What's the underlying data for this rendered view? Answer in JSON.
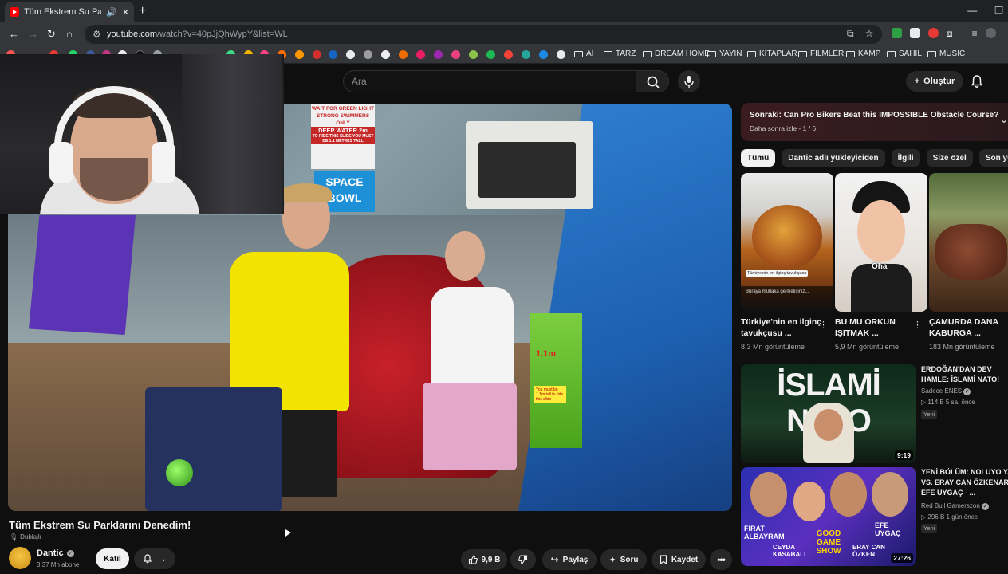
{
  "browser": {
    "tab_title": "Tüm Ekstrem Su Parklarını D",
    "new_tab": "+",
    "window_buttons": [
      "—",
      "❐"
    ],
    "url_host": "youtube.com",
    "url_path": "/watch?v=40pJjQhWypY&list=WL",
    "bookmarks": [
      {
        "label": "AI"
      },
      {
        "label": "TARZ"
      },
      {
        "label": "DREAM HOME"
      },
      {
        "label": "YAYIN"
      },
      {
        "label": "KİTAPLAR"
      },
      {
        "label": "FİLMLER"
      },
      {
        "label": "KAMP"
      },
      {
        "label": "SAHİL"
      },
      {
        "label": "MUSIC"
      }
    ]
  },
  "header": {
    "search_placeholder": "Ara",
    "create_label": "Oluştur"
  },
  "video": {
    "title": "Tüm Ekstrem Su Parklarını Denedim!",
    "dubbed_label": "Dublajlı",
    "channel": "Dantic",
    "subscribers": "3,37 Mn abone",
    "join_label": "Katıl",
    "likes": "9,9 B",
    "share_label": "Paylaş",
    "ask_label": "Soru",
    "save_label": "Kaydet",
    "scene_signs": {
      "sign1": "WAIT FOR GREEN LIGHT",
      "sign2": "STRONG SWIMMERS ONLY",
      "sign3": "DEEP WATER 2m",
      "sign4": "TO RIDE THIS SLIDE YOU MUST BE 1.1 METRES TALL",
      "bowl": "SPACE BOWL",
      "height": "1.1m",
      "height_note": "You must be 1.1m tall to ride this slide"
    }
  },
  "sidebar": {
    "next_prefix": "Sonraki:",
    "next_title": "Can Pro Bikers Beat this IMPOSSIBLE Obstacle Course?",
    "playlist_meta": "Daha sonra izle - 1 / 6",
    "chips": [
      "Tümü",
      "Dantic adlı yükleyiciden",
      "İlgili",
      "Size özel",
      "Son yükl"
    ],
    "shorts": [
      {
        "title": "Türkiye'nin en ilginç tavukçusu ...",
        "views": "8,3 Mn görüntüleme",
        "caption1": "Türkiye'nin en ilginç tavukçusu",
        "caption2": "Buraya mutlaka gelmelisiniz..."
      },
      {
        "title": "BU MU ORKUN IŞITMAK ...",
        "views": "5,9 Mn görüntüleme",
        "caption1": "Oha"
      },
      {
        "title": "ÇAMURDA DANA KABURGA ...",
        "views": "183 Mn görüntüleme"
      }
    ],
    "videos": [
      {
        "title": "ERDOĞAN'DAN DEV HAMLE: İSLAMİ NATO!",
        "channel": "Sadece ENES",
        "meta": "114 B  5 sa. önce",
        "badge": "Yeni",
        "duration": "9:19",
        "thumb_text": "İSLAMİ NATO"
      },
      {
        "title": "YENİ BÖLÜM: NOLUYO YA VS. ERAY CAN ÖZKENAR, EFE UYGAÇ - ...",
        "channel": "Red Bull Gamerszon",
        "meta": "296 B  1 gün önce",
        "badge": "Yeni",
        "duration": "27:26",
        "thumb_names": [
          "FIRAT ALBAYRAM",
          "CEYDA KASABALI",
          "EFE UYGAÇ",
          "ERAY CAN ÖZKEN"
        ],
        "thumb_logo": "GOOD GAME SHOW"
      }
    ]
  },
  "colors": {
    "yt_red": "#ff0000",
    "bg": "#0f0f0f"
  }
}
